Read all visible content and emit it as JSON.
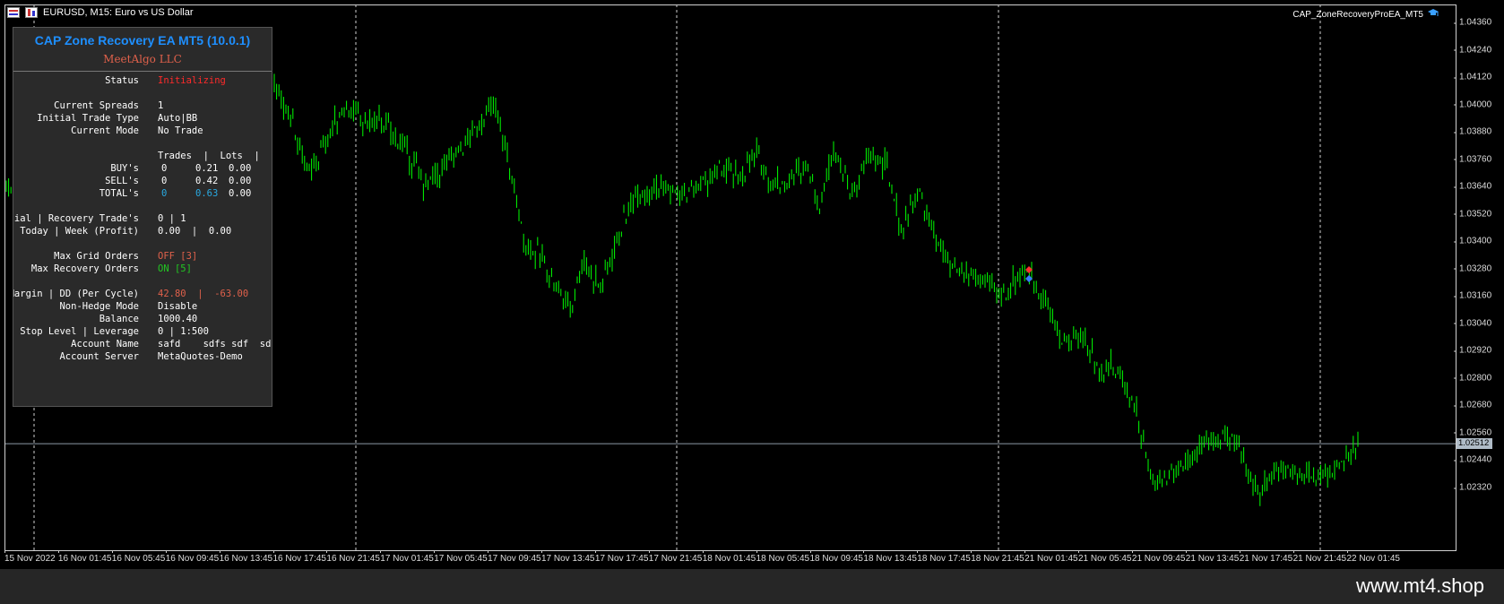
{
  "window": {
    "symbol_title": "EURUSD, M15:  Euro vs US Dollar",
    "ea_label": "CAP_ZoneRecoveryProEA_MT5"
  },
  "colors": {
    "background": "#000000",
    "candle": "#00ff00",
    "panel_bg": "#2a2a2a",
    "title_blue": "#1e8fff",
    "accent_red": "#e0614b",
    "status_red": "#ff2a2a",
    "on_green": "#22c822",
    "total_blue": "#29a9e1",
    "bid_line": "#8d99a6"
  },
  "price_axis": {
    "labels": [
      "1.04360",
      "1.04240",
      "1.04120",
      "1.04000",
      "1.03880",
      "1.03760",
      "1.03640",
      "1.03520",
      "1.03400",
      "1.03280",
      "1.03160",
      "1.03040",
      "1.02920",
      "1.02800",
      "1.02680",
      "1.02560",
      "1.02440",
      "1.02320"
    ],
    "current_price": "1.02512"
  },
  "time_axis": {
    "labels": [
      "15 Nov 2022",
      "16 Nov 01:45",
      "16 Nov 05:45",
      "16 Nov 09:45",
      "16 Nov 13:45",
      "16 Nov 17:45",
      "16 Nov 21:45",
      "17 Nov 01:45",
      "17 Nov 05:45",
      "17 Nov 09:45",
      "17 Nov 13:45",
      "17 Nov 17:45",
      "17 Nov 21:45",
      "18 Nov 01:45",
      "18 Nov 05:45",
      "18 Nov 09:45",
      "18 Nov 13:45",
      "18 Nov 17:45",
      "18 Nov 21:45",
      "21 Nov 01:45",
      "21 Nov 05:45",
      "21 Nov 09:45",
      "21 Nov 13:45",
      "21 Nov 17:45",
      "21 Nov 21:45",
      "22 Nov 01:45"
    ]
  },
  "panel": {
    "title": "CAP Zone Recovery EA MT5 (10.0.1)",
    "subtitle": "MeetAlgo LLC",
    "status_label": "Status",
    "status_value": "Initializing",
    "spreads_label": "Current Spreads",
    "spreads_value": "1",
    "trade_type_label": "Initial Trade Type",
    "trade_type_value": "Auto|BB",
    "mode_label": "Current Mode",
    "mode_value": "No Trade",
    "stats_header": "Trades  |  Lots  |  Profits",
    "buys_label": "BUY's",
    "buys": {
      "trades": "0",
      "lots": "0.21",
      "profit": "0.00"
    },
    "sells_label": "SELL's",
    "sells": {
      "trades": "0",
      "lots": "0.42",
      "profit": "0.00"
    },
    "totals_label": "TOTAL's",
    "totals": {
      "trades": "0",
      "lots": "0.63",
      "profit": "0.00"
    },
    "recovery_label": "Initial | Recovery Trade's",
    "recovery_value": "0 | 1",
    "today_label": "Today | Week (Profit)",
    "today_value": "0.00  |  0.00",
    "grid_label": "Max Grid Orders",
    "grid_value": "OFF [3]",
    "recovery_orders_label": "Max Recovery Orders",
    "recovery_orders_value": "ON [5]",
    "margin_label": "Max Margin | DD (Per Cycle)",
    "margin_value": "42.80  |  -63.00",
    "hedge_label": "Non-Hedge Mode",
    "hedge_value": "Disable",
    "balance_label": "Balance",
    "balance_value": "1000.40",
    "stop_label": "Stop Level | Leverage",
    "stop_value": "0 | 1:500",
    "account_label": "Account Name",
    "account_value": "safd    sdfs sdf  sd",
    "server_label": "Account Server",
    "server_value": "MetaQuotes-Demo"
  },
  "footer": {
    "url": "www.mt4.shop"
  }
}
